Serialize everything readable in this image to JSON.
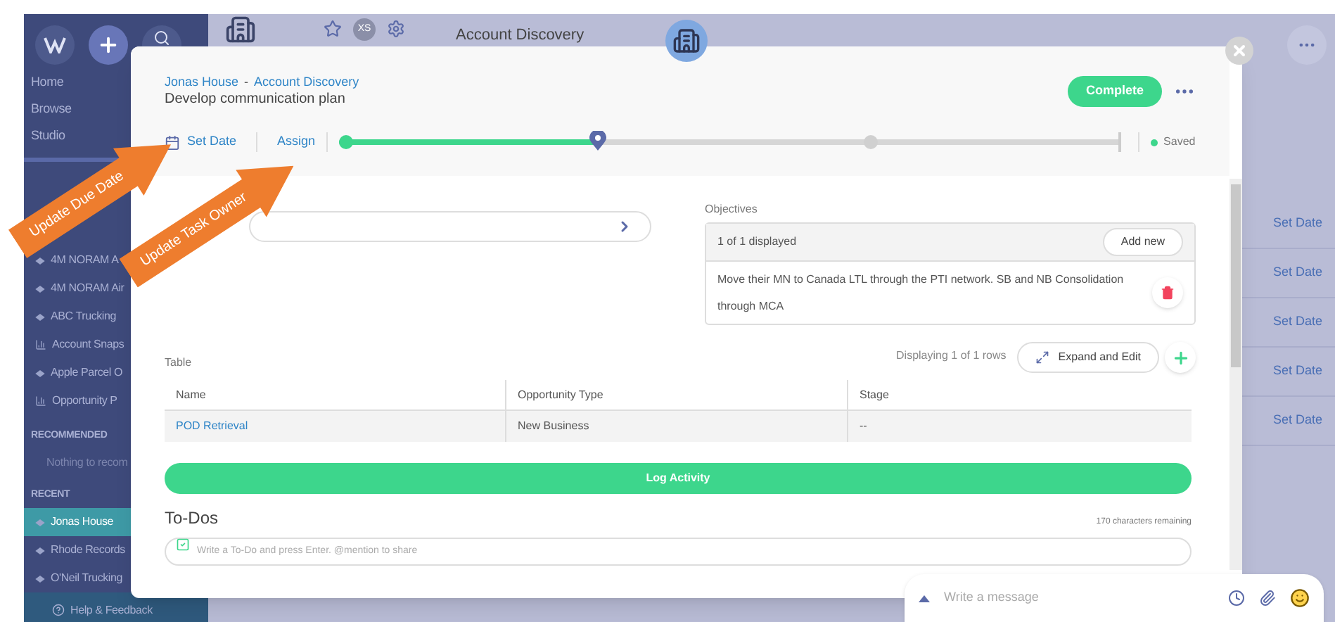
{
  "sidebar": {
    "nav": [
      "Home",
      "Browse",
      "Studio"
    ],
    "starred": [
      {
        "label": "4M NORAM A",
        "kind": "pin"
      },
      {
        "label": "4M NORAM Air",
        "kind": "pin"
      },
      {
        "label": "ABC Trucking",
        "kind": "pin"
      },
      {
        "label": "Account Snaps",
        "kind": "chart"
      },
      {
        "label": "Apple Parcel O",
        "kind": "pin"
      },
      {
        "label": "Opportunity P",
        "kind": "chart"
      }
    ],
    "recommended": {
      "heading": "RECOMMENDED",
      "empty": "Nothing to recom"
    },
    "recent": {
      "heading": "RECENT",
      "items": [
        {
          "label": "Jonas House",
          "selected": true
        },
        {
          "label": "Rhode Records",
          "selected": false
        },
        {
          "label": "O'Neil Trucking",
          "selected": false
        }
      ]
    },
    "help": "Help & Feedback"
  },
  "background": {
    "title": "Account Discovery",
    "avatar": "XS",
    "set_date_links": [
      "Set Date",
      "Set Date",
      "Set Date",
      "Set Date",
      "Set Date"
    ]
  },
  "task": {
    "breadcrumb": [
      "Jonas House",
      "Account Discovery"
    ],
    "separator": "-",
    "title": "Develop communication plan",
    "complete": "Complete",
    "set_date": "Set Date",
    "assign": "Assign",
    "progress": {
      "level": 0.33
    },
    "status": "Saved"
  },
  "objectives": {
    "label": "Objectives",
    "count": "1 of 1 displayed",
    "add": "Add new",
    "items": [
      "Move their MN to Canada LTL through the PTI network. SB and NB Consolidation through MCA"
    ]
  },
  "table": {
    "label": "Table",
    "summary": "Displaying 1 of 1 rows",
    "expand": "Expand and Edit",
    "columns": [
      "Name",
      "Opportunity Type",
      "Stage"
    ],
    "rows": [
      [
        "POD Retrieval",
        "New Business",
        "--"
      ]
    ]
  },
  "log_activity": "Log Activity",
  "todos": {
    "heading": "To-Dos",
    "remaining": "170 characters remaining",
    "placeholder": "Write a To-Do and press Enter. @mention to share"
  },
  "chat": {
    "placeholder": "Write a message"
  },
  "callouts": [
    "Update Due Date",
    "Update Task Owner"
  ]
}
